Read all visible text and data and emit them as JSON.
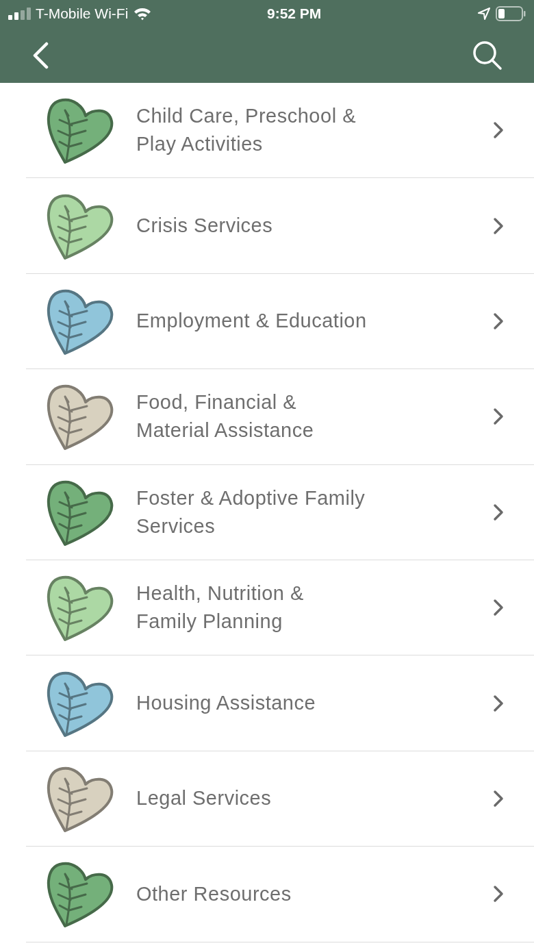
{
  "status_bar": {
    "carrier": "T-Mobile Wi-Fi",
    "time": "9:52 PM"
  },
  "categories": [
    {
      "label": "Child Care, Preschool & Play Activities",
      "color": "#74b07a"
    },
    {
      "label": "Crisis Services",
      "color": "#acd8a4"
    },
    {
      "label": "Employment & Education",
      "color": "#90c5da"
    },
    {
      "label": "Food, Financial & Material Assistance",
      "color": "#d8d1bf"
    },
    {
      "label": "Foster & Adoptive Family Services",
      "color": "#74b07a"
    },
    {
      "label": "Health, Nutrition & Family Planning",
      "color": "#acd8a4"
    },
    {
      "label": "Housing Assistance",
      "color": "#90c5da"
    },
    {
      "label": "Legal Services",
      "color": "#d8d1bf"
    },
    {
      "label": "Other Resources",
      "color": "#74b07a"
    }
  ]
}
